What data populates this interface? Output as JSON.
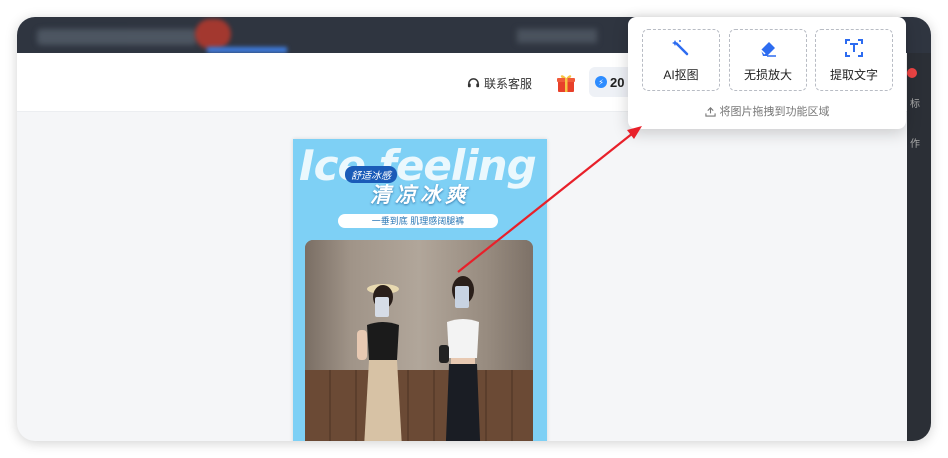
{
  "header": {
    "contact_label": "联系客服",
    "credits_value": "20"
  },
  "canvas": {
    "ice_text": "Ice feeling",
    "badge": "舒适冰感",
    "subtitle": "清凉冰爽",
    "tagline": "一垂到底 肌理感阔腿裤"
  },
  "popup": {
    "tools": [
      {
        "label": "AI抠图",
        "icon": "magic-wand-icon"
      },
      {
        "label": "无损放大",
        "icon": "eraser-icon"
      },
      {
        "label": "提取文字",
        "icon": "text-extract-icon"
      }
    ],
    "hint": "将图片拖拽到功能区域"
  },
  "right_panel": {
    "text1": "标",
    "text2": "作"
  },
  "colors": {
    "accent": "#2d8cff",
    "arrow": "#e8202a",
    "poster_bg": "#7ed0f5"
  }
}
